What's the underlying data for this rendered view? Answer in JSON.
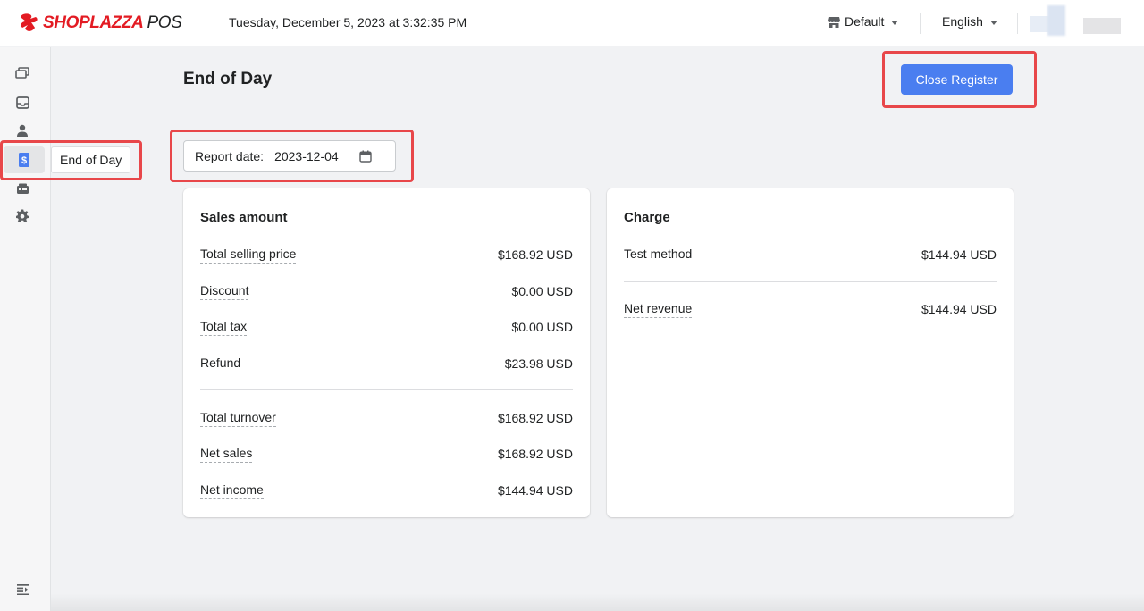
{
  "header": {
    "brand": "SHOPLAZZA",
    "brand_suffix": "POS",
    "datetime": "Tuesday, December 5, 2023 at 3:32:35 PM",
    "store": "Default",
    "language": "English"
  },
  "sidebar": {
    "items": [
      {
        "name": "orders",
        "icon": "tickets-icon"
      },
      {
        "name": "inbox",
        "icon": "inbox-icon"
      },
      {
        "name": "customers",
        "icon": "person-icon"
      },
      {
        "name": "end-of-day",
        "icon": "dollar-receipt-icon"
      },
      {
        "name": "register",
        "icon": "register-icon"
      },
      {
        "name": "settings",
        "icon": "gear-icon"
      }
    ],
    "tooltip": "End of Day",
    "collapse_icon": "collapse-menu-icon"
  },
  "page": {
    "title": "End of Day",
    "close_button": "Close Register",
    "report_date_label": "Report date:",
    "report_date_value": "2023-12-04"
  },
  "sales": {
    "title": "Sales amount",
    "rows": [
      {
        "label": "Total selling price",
        "value": "$168.92 USD"
      },
      {
        "label": "Discount",
        "value": "$0.00 USD"
      },
      {
        "label": "Total tax",
        "value": "$0.00 USD"
      },
      {
        "label": "Refund",
        "value": "$23.98 USD"
      },
      {
        "label": "Total turnover",
        "value": "$168.92 USD"
      },
      {
        "label": "Net sales",
        "value": "$168.92 USD"
      },
      {
        "label": "Net income",
        "value": "$144.94 USD"
      }
    ]
  },
  "charge": {
    "title": "Charge",
    "rows": [
      {
        "label": "Test method",
        "value": "$144.94 USD"
      },
      {
        "label": "Net revenue",
        "value": "$144.94 USD"
      }
    ]
  },
  "colors": {
    "accent": "#4a7ef0",
    "brand": "#e31b23",
    "highlight": "#e8474a"
  }
}
